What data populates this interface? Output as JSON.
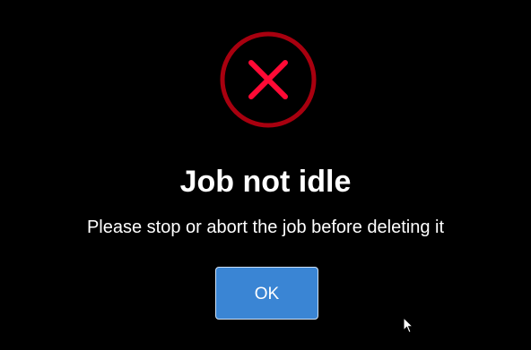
{
  "dialog": {
    "icon": "error-x-circle-icon",
    "title": "Job not idle",
    "message": "Please stop or abort the job before deleting it",
    "ok_label": "OK"
  },
  "colors": {
    "background": "#000000",
    "icon_ring": "#a8000f",
    "icon_cross": "#ff0a35",
    "button_bg": "#3a85d4",
    "button_border": "#cfe2f6",
    "text": "#ffffff"
  }
}
